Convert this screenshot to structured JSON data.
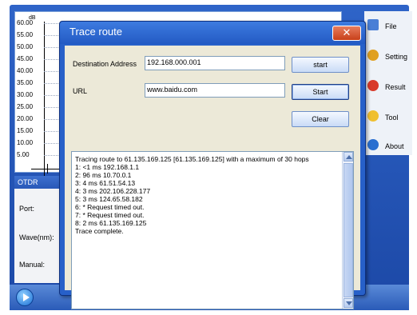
{
  "chart": {
    "unit": "dB",
    "y_ticks": [
      "60.00",
      "55.00",
      "50.00",
      "45.00",
      "40.00",
      "35.00",
      "30.00",
      "25.00",
      "20.00",
      "15.00",
      "10.00",
      "5.00"
    ]
  },
  "otdr": {
    "header": "OTDR",
    "port_label": "Port:",
    "wave_label": "Wave(nm):",
    "manual_label": "Manual:"
  },
  "side_menu": {
    "items": [
      {
        "label": "File",
        "icon": "file-icon",
        "color": "#4a7fd6"
      },
      {
        "label": "Setting",
        "icon": "setting-icon",
        "color": "#e0a020"
      },
      {
        "label": "Result",
        "icon": "result-icon",
        "color": "#d83a2a"
      },
      {
        "label": "Tool",
        "icon": "tool-icon",
        "color": "#f0c030"
      },
      {
        "label": "About",
        "icon": "about-icon",
        "color": "#2a6fd0"
      }
    ]
  },
  "dialog": {
    "title": "Trace route",
    "close_glyph": "✕",
    "destination_label": "Destination Address",
    "destination_value": "192.168.000.001",
    "destination_button": "start",
    "url_label": "URL",
    "url_value": "www.baidu.com",
    "url_button": "Start",
    "clear_button": "Clear",
    "output_lines": [
      "Tracing route to 61.135.169.125 [61.135.169.125] with a maximum of 30 hops",
      "1:   <1 ms   192.168.1.1",
      "2:   96 ms    10.70.0.1",
      "3:   4 ms    61.51.54.13",
      "4:   3 ms    202.106.228.177",
      "5:   3 ms    124.65.58.182",
      "6:   *    Request timed out.",
      "7:   *    Request timed out.",
      "8:   2 ms    61.135.169.125",
      "Trace complete."
    ]
  },
  "colors": {
    "frame_blue": "#2760c9",
    "button_face": "#c9dbf6"
  }
}
